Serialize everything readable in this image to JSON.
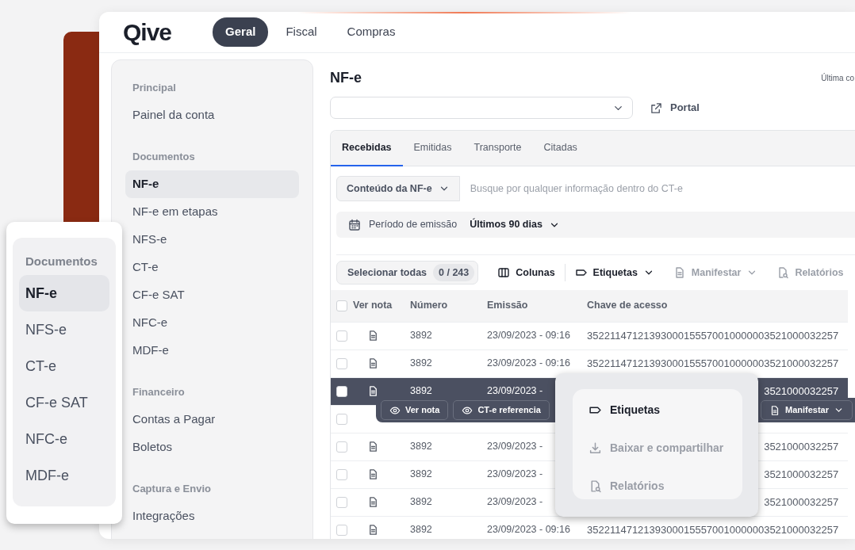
{
  "logo": {
    "text": "Qive"
  },
  "top_tabs": [
    {
      "label": "Geral",
      "selected": true
    },
    {
      "label": "Fiscal",
      "selected": false
    },
    {
      "label": "Compras",
      "selected": false
    }
  ],
  "sidebar": {
    "sections": [
      {
        "heading": "Principal",
        "items": [
          {
            "label": "Painel da conta",
            "selected": false
          }
        ]
      },
      {
        "heading": "Documentos",
        "items": [
          {
            "label": "NF-e",
            "selected": true
          },
          {
            "label": "NF-e em etapas",
            "selected": false
          },
          {
            "label": "NFS-e",
            "selected": false
          },
          {
            "label": "CT-e",
            "selected": false
          },
          {
            "label": "CF-e SAT",
            "selected": false
          },
          {
            "label": "NFC-e",
            "selected": false
          },
          {
            "label": "MDF-e",
            "selected": false
          }
        ]
      },
      {
        "heading": "Financeiro",
        "items": [
          {
            "label": "Contas a Pagar",
            "selected": false
          },
          {
            "label": "Boletos",
            "selected": false
          }
        ]
      },
      {
        "heading": "Captura e Envio",
        "items": [
          {
            "label": "Integrações",
            "selected": false
          }
        ]
      }
    ]
  },
  "page": {
    "title": "NF-e",
    "last_update": "Última co",
    "portal_link": "Portal"
  },
  "doc_tabs": [
    {
      "label": "Recebidas",
      "selected": true
    },
    {
      "label": "Emitidas",
      "selected": false
    },
    {
      "label": "Transporte",
      "selected": false
    },
    {
      "label": "Citadas",
      "selected": false
    }
  ],
  "search": {
    "scope": "Conteúdo da NF-e",
    "placeholder": "Busque por qualquer informação dentro do CT-e"
  },
  "period": {
    "label": "Período de emissão",
    "value": "Últimos 90 dias"
  },
  "toolbar": {
    "select_all": "Selecionar todas",
    "count": "0 / 243",
    "actions": [
      {
        "label": "Colunas",
        "kind": "columns",
        "dropdown": false,
        "disabled": false
      },
      {
        "label": "Etiquetas",
        "kind": "tag",
        "dropdown": true,
        "disabled": false
      },
      {
        "label": "Manifestar",
        "kind": "doc",
        "dropdown": true,
        "disabled": true
      },
      {
        "label": "Relatórios",
        "kind": "report",
        "dropdown": false,
        "disabled": true
      }
    ]
  },
  "table": {
    "all_checked": false,
    "columns": [
      "Ver nota",
      "Número",
      "Emissão",
      "Chave de acesso"
    ],
    "rows": [
      {
        "kind": "note",
        "selected": false,
        "checked": false,
        "number": "3892",
        "issued": "23/09/2023 - 09:16",
        "key": "35221147121393000155570010000003521000032257"
      },
      {
        "kind": "note",
        "selected": false,
        "checked": false,
        "number": "3892",
        "issued": "23/09/2023 - 09:16",
        "key": "35221147121393000155570010000003521000032257"
      },
      {
        "kind": "note",
        "selected": true,
        "checked": false,
        "number": "3892",
        "issued": "23/09/2023 -",
        "key": "3521000032257"
      },
      {
        "kind": "actions",
        "selected": false,
        "checked": false,
        "actions": [
          {
            "label": "Ver nota",
            "kind": "eye",
            "dropdown": false
          },
          {
            "label": "CT-e referencia",
            "kind": "eye",
            "dropdown": false
          },
          {
            "label": "Manifestar",
            "kind": "doc",
            "dropdown": true
          }
        ]
      },
      {
        "kind": "note",
        "selected": false,
        "checked": false,
        "number": "3892",
        "issued": "23/09/2023 -",
        "key": "3521000032257"
      },
      {
        "kind": "note",
        "selected": false,
        "checked": false,
        "number": "3892",
        "issued": "23/09/2023 -",
        "key": "3521000032257"
      },
      {
        "kind": "note",
        "selected": false,
        "checked": false,
        "number": "3892",
        "issued": "23/09/2023 -",
        "key": "3521000032257"
      },
      {
        "kind": "note",
        "selected": false,
        "checked": false,
        "number": "3892",
        "issued": "23/09/2023 - 09:16",
        "key": "35221147121393000155570010000003521000032257"
      }
    ]
  },
  "floating_menu": {
    "heading": "Documentos",
    "items": [
      {
        "label": "NF-e",
        "selected": true
      },
      {
        "label": "NFS-e",
        "selected": false
      },
      {
        "label": "CT-e",
        "selected": false
      },
      {
        "label": "CF-e SAT",
        "selected": false
      },
      {
        "label": "NFC-e",
        "selected": false
      },
      {
        "label": "MDF-e",
        "selected": false
      }
    ]
  },
  "popup_menu": {
    "items": [
      {
        "label": "Etiquetas",
        "kind": "tag",
        "disabled": false
      },
      {
        "label": "Baixar e compartilhar",
        "kind": "download",
        "disabled": true
      },
      {
        "label": "Relatórios",
        "kind": "report",
        "disabled": true
      }
    ]
  }
}
